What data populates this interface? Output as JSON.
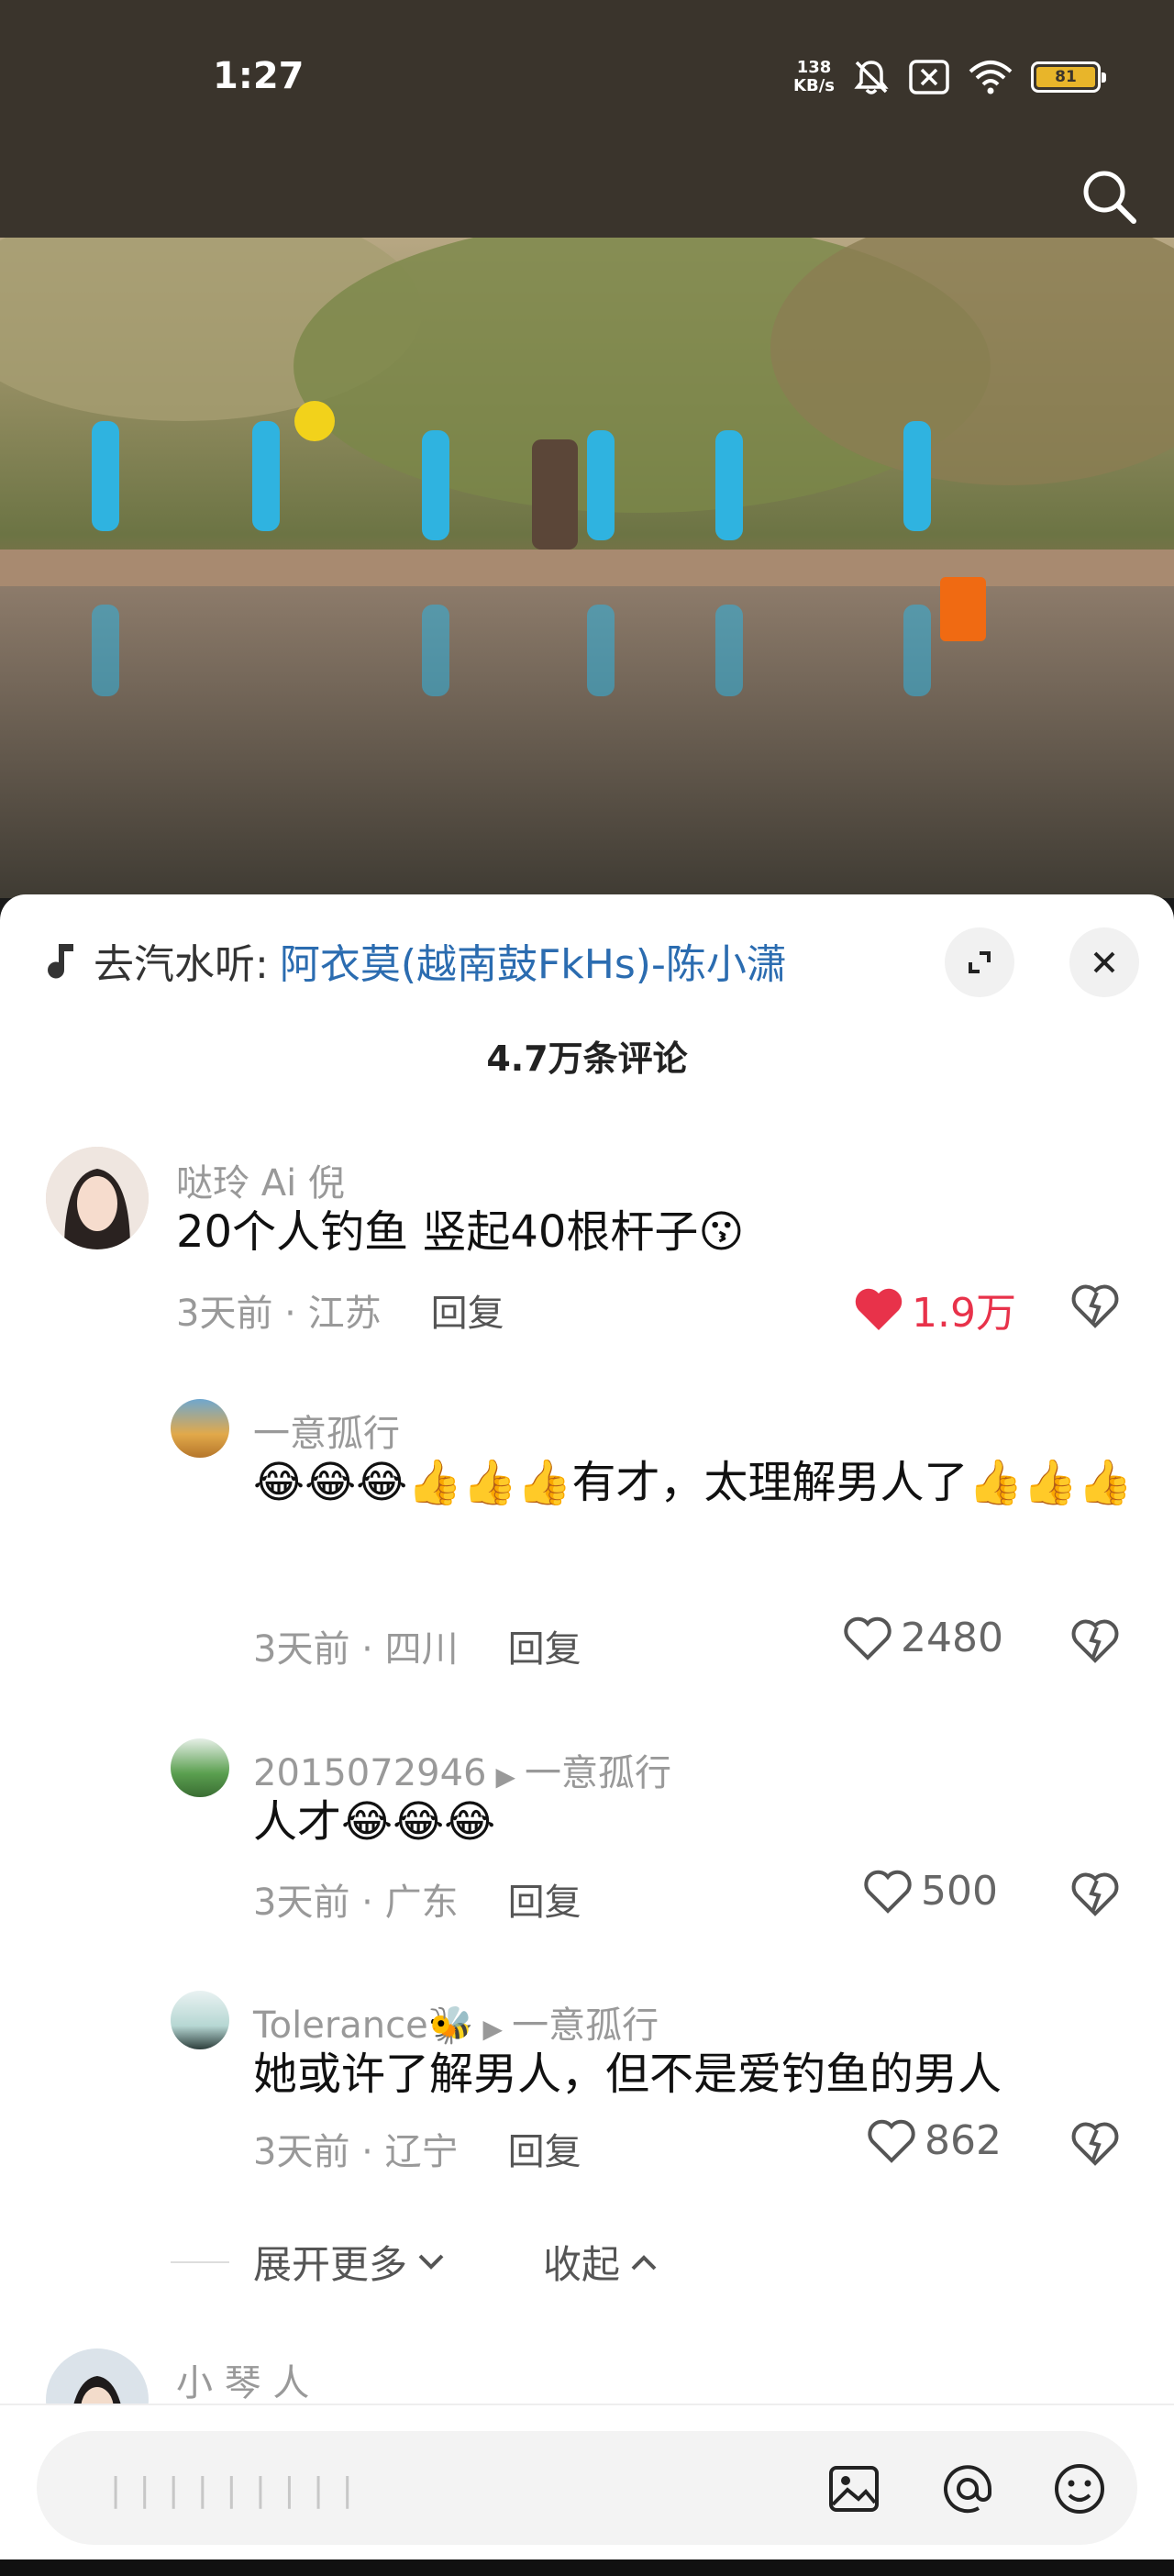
{
  "status_bar": {
    "time": "1:27",
    "net_speed_value": "138",
    "net_speed_unit": "KB/s",
    "battery": "81"
  },
  "music": {
    "prefix": "去汽水听:",
    "title": "阿衣莫(越南鼓FkHs)-陈小潇"
  },
  "comment_count": "4.7万条评论",
  "comments": [
    {
      "user": "哒玲 Ai 倪",
      "text": "20个人钓鱼 竖起40根杆子😗",
      "time": "3天前",
      "location": "江苏",
      "reply": "回复",
      "likes": "1.9万"
    },
    {
      "user": "一意孤行",
      "text": "😂😂😂👍👍👍有才，太理解男人了👍👍👍",
      "time": "3天前",
      "location": "四川",
      "reply": "回复",
      "likes": "2480"
    },
    {
      "user": "2015072946",
      "reply_to": "一意孤行",
      "text": "人才😂😂😂",
      "time": "3天前",
      "location": "广东",
      "reply": "回复",
      "likes": "500"
    },
    {
      "user": "Tolerance🐝",
      "reply_to": "一意孤行",
      "text": "她或许了解男人，但不是爱钓鱼的男人",
      "time": "3天前",
      "location": "辽宁",
      "reply": "回复",
      "likes": "862"
    },
    {
      "user": "小 琴 人"
    }
  ],
  "expand": {
    "more": "展开更多",
    "collapse": "收起"
  },
  "input": {
    "placeholder": "| | | | | | | | |"
  },
  "colors": {
    "accent_like": "#e8324a",
    "link": "#2b6cb0",
    "status_bg": "#3a342c"
  }
}
